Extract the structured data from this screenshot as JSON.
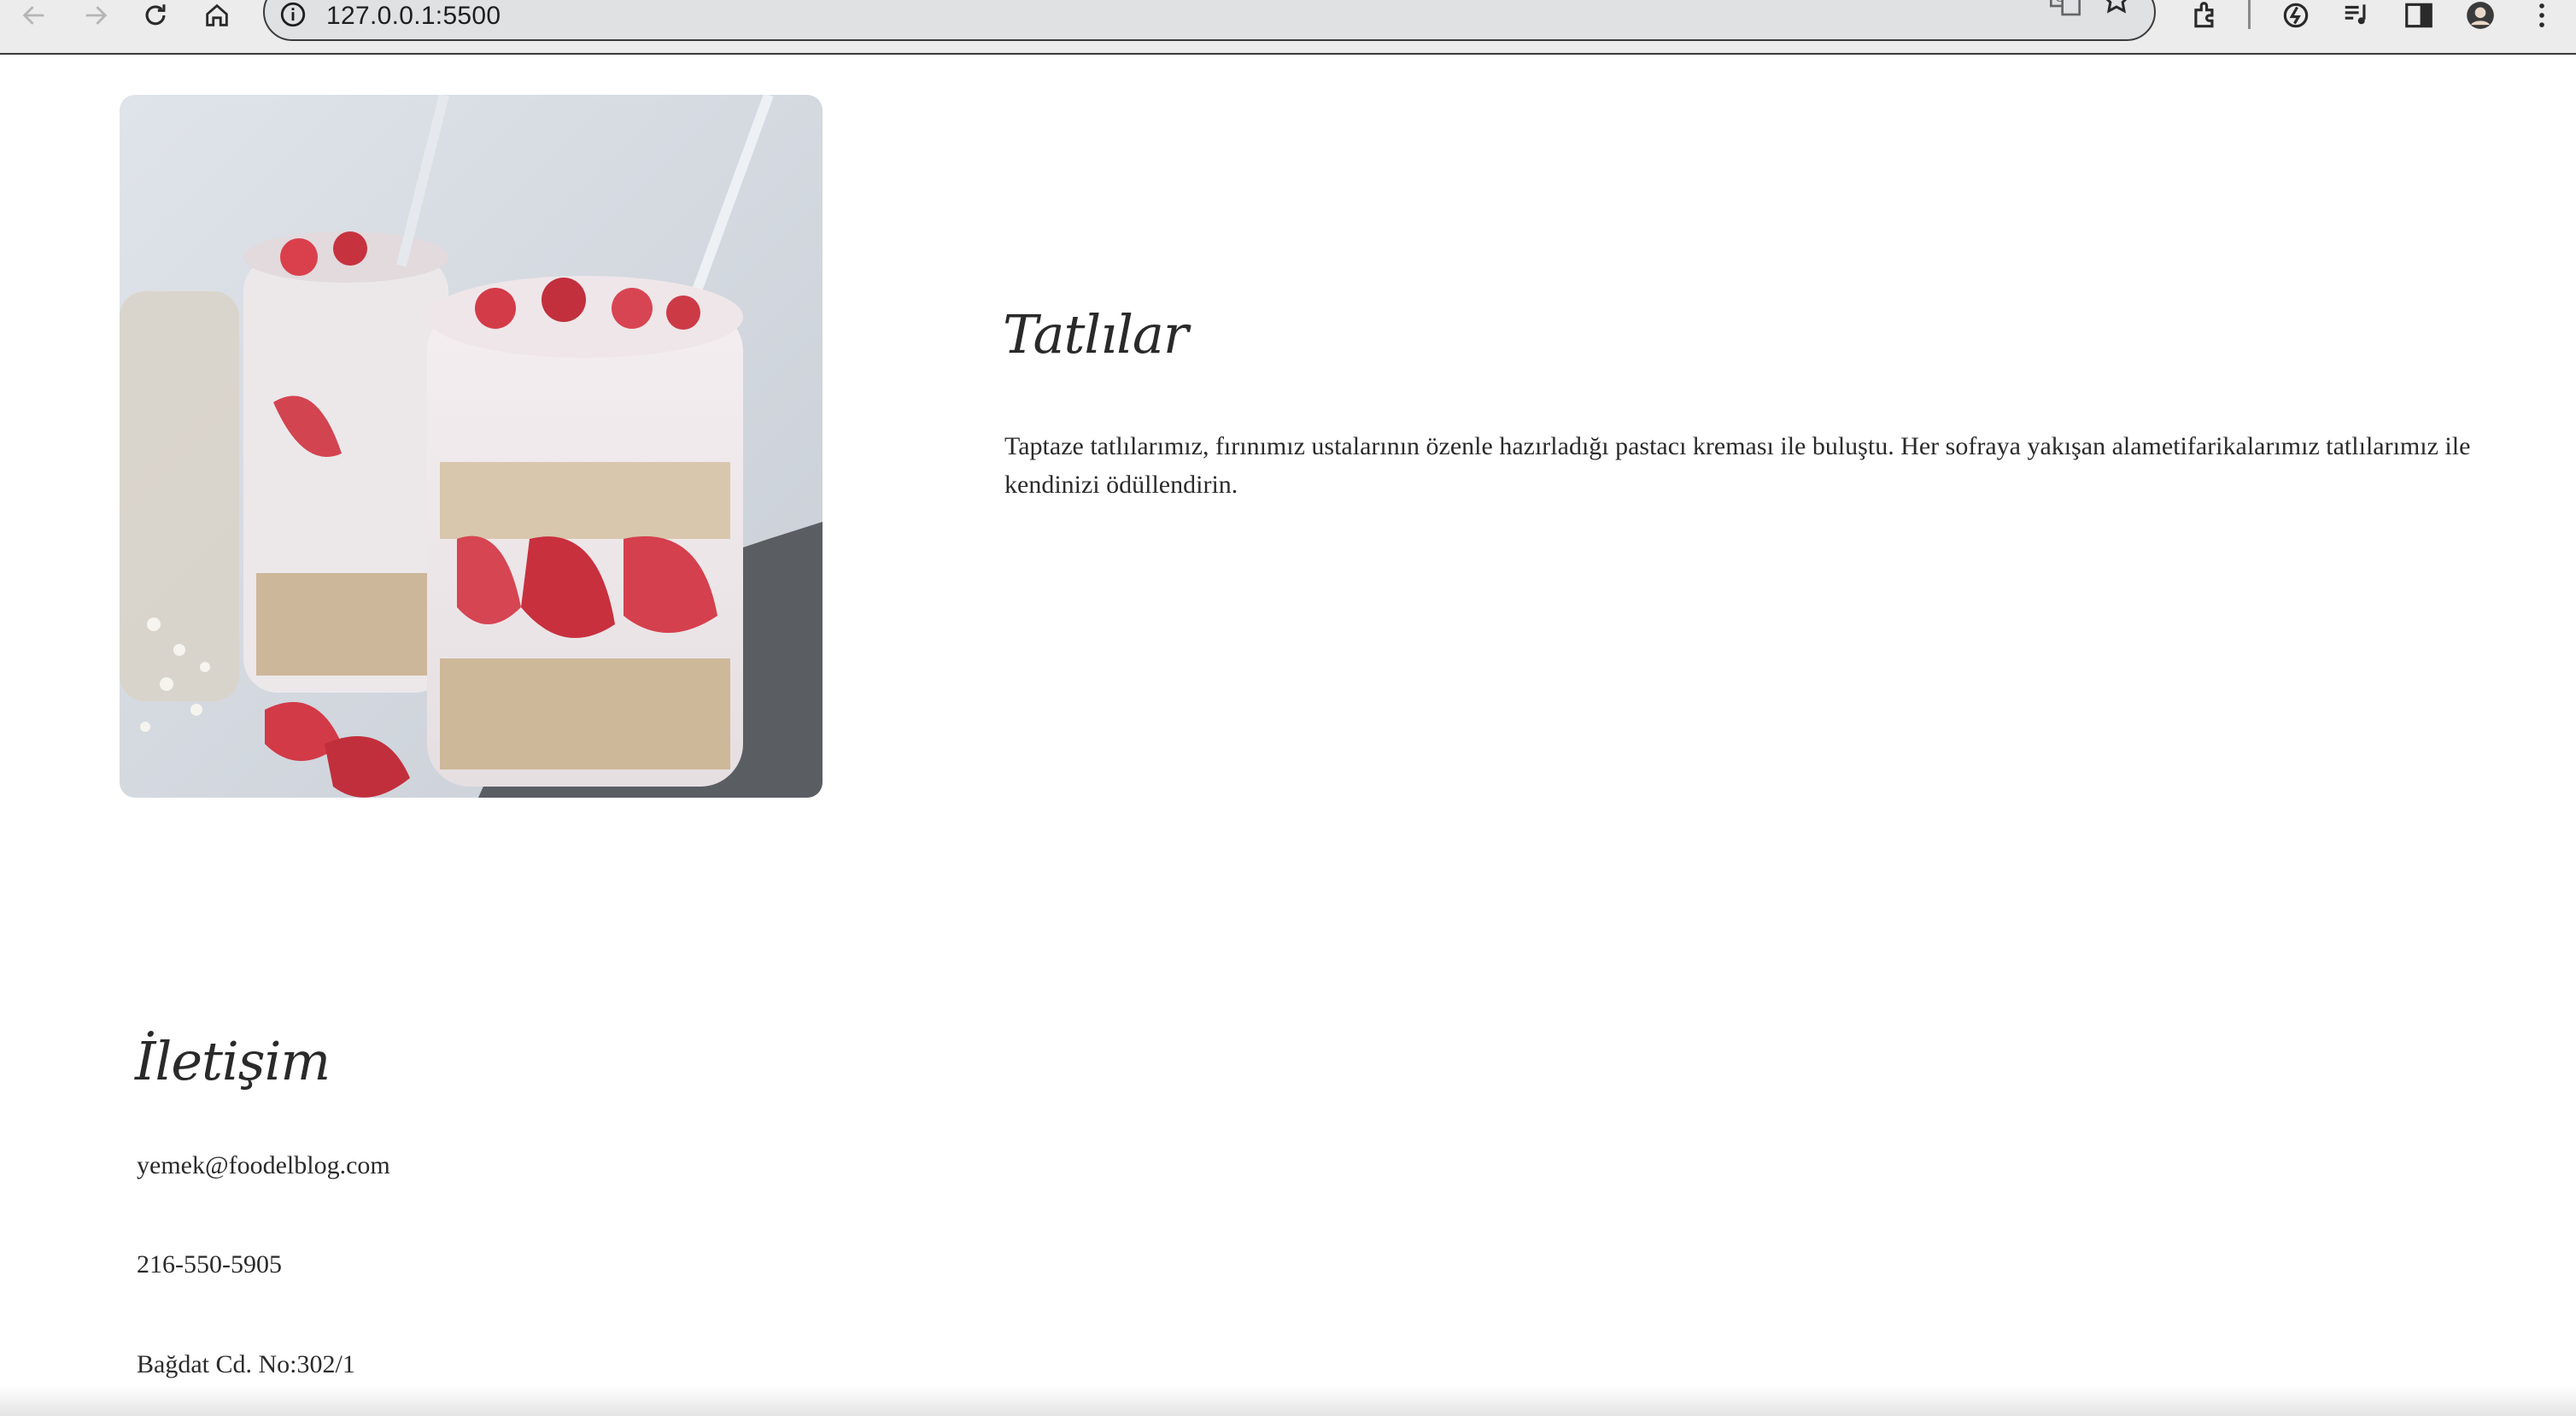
{
  "browser": {
    "url": "127.0.0.1:5500",
    "icons": [
      "back-icon",
      "forward-icon",
      "reload-icon",
      "home-icon",
      "info-icon",
      "translate-icon",
      "star-icon",
      "extensions-icon",
      "sync-icon",
      "media-icon",
      "sidepanel-icon",
      "profile-icon",
      "menu-icon"
    ]
  },
  "desserts": {
    "title": "Tatlılar",
    "description": "Taptaze tatlılarımız, fırınımız ustalarının özenle hazırladığı pastacı kreması ile buluştu. Her sofraya yakışan alametifarikalarımız tatlılarımız ile kendinizi ödüllendirin."
  },
  "contact": {
    "title": "İletişim",
    "email": "yemek@foodelblog.com",
    "phone": "216-550-5905",
    "address": "Bağdat Cd. No:302/1"
  }
}
